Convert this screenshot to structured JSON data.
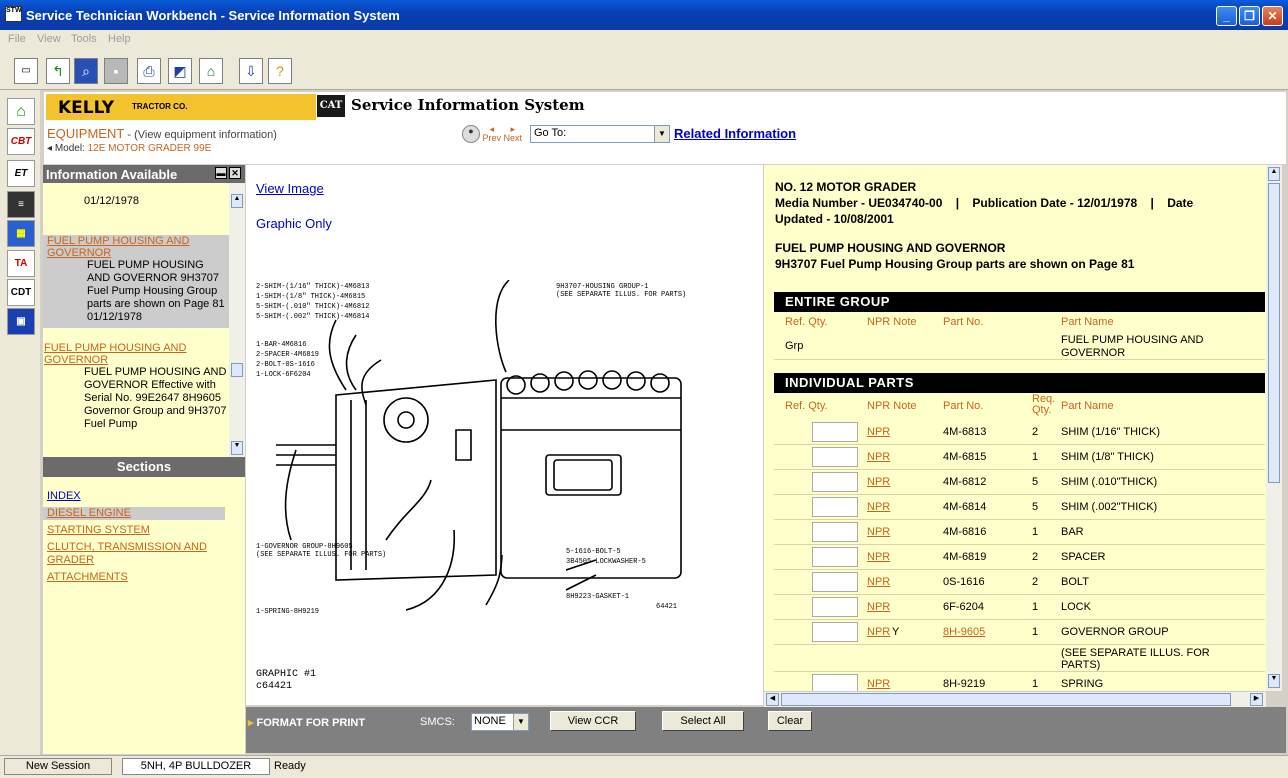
{
  "window": {
    "title": "Service Technician Workbench - Service Information System",
    "app_icon_text": "STW"
  },
  "menu": [
    "File",
    "View",
    "Tools",
    "Help"
  ],
  "header": {
    "brand": "KELLY",
    "brand_sub": "TRACTOR CO.",
    "cat": "CAT",
    "system_title": "Service Information System",
    "equipment_label": "EQUIPMENT",
    "equipment_sub": " - (View equipment information)",
    "model_label": "Model:",
    "model_value": "12E MOTOR GRADER 99E",
    "prev": "Prev",
    "next": "Next",
    "goto": "Go To:",
    "related": "Related Information"
  },
  "info_panel": {
    "title": "Information Available",
    "items": [
      {
        "date": "01/12/1978"
      },
      {
        "link": "FUEL PUMP HOUSING AND GOVERNOR",
        "text": "FUEL PUMP HOUSING AND GOVERNOR 9H3707 Fuel Pump Housing Group parts are shown on Page 81",
        "date": "01/12/1978"
      },
      {
        "link": "FUEL PUMP HOUSING AND GOVERNOR",
        "text": "FUEL PUMP HOUSING AND GOVERNOR Effective with Serial No. 99E2647 8H9605 Governor Group and 9H3707 Fuel Pump"
      }
    ],
    "sections_title": "Sections",
    "sections": [
      "INDEX",
      "DIESEL ENGINE",
      "STARTING SYSTEM",
      "CLUTCH, TRANSMISSION AND GRADER",
      "ATTACHMENTS"
    ]
  },
  "graphic": {
    "view_image": "View Image",
    "graphic_only": "Graphic Only",
    "graphic_num": "GRAPHIC #1",
    "graphic_id": "c64421",
    "labels": [
      "2-SHIM-(1/16\" THICK)-4M6813",
      "1-SHIM-(1/8\" THICK)-4M6815",
      "5-SHIM-(.010\" THICK)-4M6812",
      "5-SHIM-(.002\" THICK)-4M6814",
      "1-BAR-4M6816",
      "2-SPACER-4M6819",
      "2-BOLT-0S-1616",
      "1-LOCK-6F6204",
      "9H3707-HOUSING GROUP-1",
      "(SEE SEPARATE ILLUS. FOR PARTS)",
      "1-GOVERNOR GROUP-8H9605",
      "(SEE SEPARATE ILLUS. FOR PARTS)",
      "1-SPRING-8H9219",
      "5-1616-BOLT-5",
      "3B4505-LOCKWASHER-5",
      "8H9223-GASKET-1",
      "64421"
    ]
  },
  "parts": {
    "title_lines": [
      "NO. 12 MOTOR GRADER",
      "Media Number - UE034740-00    |    Publication Date - 12/01/1978    |    Date",
      "Updated - 10/08/2001"
    ],
    "section_title": "FUEL PUMP HOUSING AND GOVERNOR",
    "section_desc": "9H3707 Fuel Pump Housing Group parts are shown on Page 81",
    "entire_group": "ENTIRE GROUP",
    "individual_parts": "INDIVIDUAL PARTS",
    "cols": {
      "ref": "Ref. Qty.",
      "npr": "NPR Note",
      "part": "Part No.",
      "req": "Req. Qty.",
      "name": "Part Name"
    },
    "group_row": {
      "ref": "Grp",
      "name": "FUEL PUMP HOUSING AND GOVERNOR"
    },
    "rows": [
      {
        "npr": "NPR",
        "note": "",
        "part": "4M-6813",
        "qty": "2",
        "name": "SHIM (1/16\" THICK)"
      },
      {
        "npr": "NPR",
        "note": "",
        "part": "4M-6815",
        "qty": "1",
        "name": "SHIM (1/8\" THICK)"
      },
      {
        "npr": "NPR",
        "note": "",
        "part": "4M-6812",
        "qty": "5",
        "name": "SHIM (.010\"THICK)"
      },
      {
        "npr": "NPR",
        "note": "",
        "part": "4M-6814",
        "qty": "5",
        "name": "SHIM (.002\"THICK)"
      },
      {
        "npr": "NPR",
        "note": "",
        "part": "4M-6816",
        "qty": "1",
        "name": "BAR"
      },
      {
        "npr": "NPR",
        "note": "",
        "part": "4M-6819",
        "qty": "2",
        "name": "SPACER"
      },
      {
        "npr": "NPR",
        "note": "",
        "part": "0S-1616",
        "qty": "2",
        "name": "BOLT"
      },
      {
        "npr": "NPR",
        "note": "",
        "part": "6F-6204",
        "qty": "1",
        "name": "LOCK"
      },
      {
        "npr": "NPR",
        "note": "Y",
        "part": "8H-9605",
        "qty": "1",
        "name": "GOVERNOR GROUP"
      },
      {
        "npr": "",
        "note": "",
        "part": "",
        "qty": "",
        "name": "(SEE SEPARATE ILLUS. FOR PARTS)"
      },
      {
        "npr": "NPR",
        "note": "",
        "part": "8H-9219",
        "qty": "1",
        "name": "SPRING"
      }
    ]
  },
  "bottom": {
    "format": "FORMAT FOR PRINT",
    "smcs_label": "SMCS:",
    "smcs_value": "NONE",
    "view_ccr": "View CCR",
    "select_all": "Select All",
    "clear": "Clear"
  },
  "status": {
    "new_session": "New Session",
    "machine": "5NH, 4P BULLDOZER",
    "state": "Ready"
  },
  "left_tools": [
    "CBT",
    "ET",
    "TA",
    "CDT"
  ],
  "colors": {
    "accent": "#c8651b",
    "panel": "#ffffcc",
    "title_blue": "#0a5bd8",
    "kelly_yellow": "#f4c22e"
  }
}
